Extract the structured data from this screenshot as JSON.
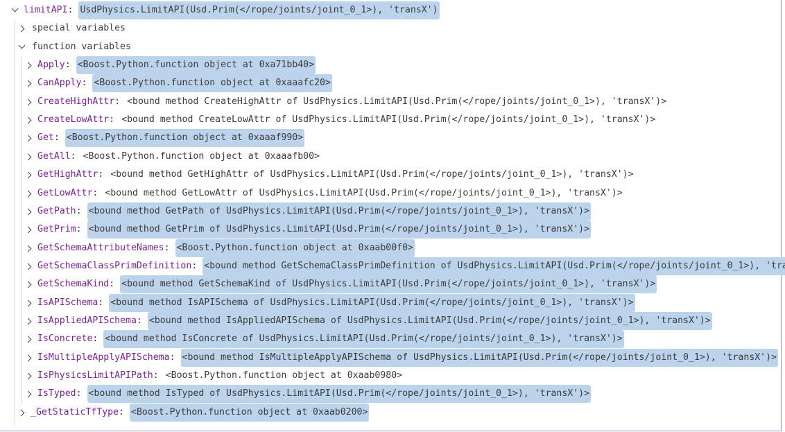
{
  "root": {
    "name": "limitAPI",
    "value": "UsdPhysics.LimitAPI(Usd.Prim(</rope/joints/joint_0_1>), 'transX')",
    "selected": true
  },
  "groups": {
    "special": "special variables",
    "function": "function variables"
  },
  "items": [
    {
      "name": "Apply",
      "value": "<Boost.Python.function object at 0xa71bb40>",
      "selected": true
    },
    {
      "name": "CanApply",
      "value": "<Boost.Python.function object at 0xaaafc20>",
      "selected": true
    },
    {
      "name": "CreateHighAttr",
      "value": "<bound method CreateHighAttr of UsdPhysics.LimitAPI(Usd.Prim(</rope/joints/joint_0_1>), 'transX')>",
      "selected": false
    },
    {
      "name": "CreateLowAttr",
      "value": "<bound method CreateLowAttr of UsdPhysics.LimitAPI(Usd.Prim(</rope/joints/joint_0_1>), 'transX')>",
      "selected": false
    },
    {
      "name": "Get",
      "value": "<Boost.Python.function object at 0xaaaf990>",
      "selected": true
    },
    {
      "name": "GetAll",
      "value": "<Boost.Python.function object at 0xaaafb00>",
      "selected": false
    },
    {
      "name": "GetHighAttr",
      "value": "<bound method GetHighAttr of UsdPhysics.LimitAPI(Usd.Prim(</rope/joints/joint_0_1>), 'transX')>",
      "selected": false
    },
    {
      "name": "GetLowAttr",
      "value": "<bound method GetLowAttr of UsdPhysics.LimitAPI(Usd.Prim(</rope/joints/joint_0_1>), 'transX')>",
      "selected": false
    },
    {
      "name": "GetPath",
      "value": "<bound method GetPath of UsdPhysics.LimitAPI(Usd.Prim(</rope/joints/joint_0_1>), 'transX')>",
      "selected": true
    },
    {
      "name": "GetPrim",
      "value": "<bound method GetPrim of UsdPhysics.LimitAPI(Usd.Prim(</rope/joints/joint_0_1>), 'transX')>",
      "selected": true
    },
    {
      "name": "GetSchemaAttributeNames",
      "value": "<Boost.Python.function object at 0xaab00f0>",
      "selected": true
    },
    {
      "name": "GetSchemaClassPrimDefinition",
      "value": "<bound method GetSchemaClassPrimDefinition of UsdPhysics.LimitAPI(Usd.Prim(</rope/joints/joint_0_1>), 'tran…",
      "selected": true
    },
    {
      "name": "GetSchemaKind",
      "value": "<bound method GetSchemaKind of UsdPhysics.LimitAPI(Usd.Prim(</rope/joints/joint_0_1>), 'transX')>",
      "selected": true
    },
    {
      "name": "IsAPISchema",
      "value": "<bound method IsAPISchema of UsdPhysics.LimitAPI(Usd.Prim(</rope/joints/joint_0_1>), 'transX')>",
      "selected": true
    },
    {
      "name": "IsAppliedAPISchema",
      "value": "<bound method IsAppliedAPISchema of UsdPhysics.LimitAPI(Usd.Prim(</rope/joints/joint_0_1>), 'transX')>",
      "selected": true
    },
    {
      "name": "IsConcrete",
      "value": "<bound method IsConcrete of UsdPhysics.LimitAPI(Usd.Prim(</rope/joints/joint_0_1>), 'transX')>",
      "selected": true
    },
    {
      "name": "IsMultipleApplyAPISchema",
      "value": "<bound method IsMultipleApplyAPISchema of UsdPhysics.LimitAPI(Usd.Prim(</rope/joints/joint_0_1>), 'transX')>",
      "selected": true
    },
    {
      "name": "IsPhysicsLimitAPIPath",
      "value": "<Boost.Python.function object at 0xaab0980>",
      "selected": false
    },
    {
      "name": "IsTyped",
      "value": "<bound method IsTyped of UsdPhysics.LimitAPI(Usd.Prim(</rope/joints/joint_0_1>), 'transX')>",
      "selected": true
    }
  ],
  "tail": {
    "name": "_GetStaticTfType",
    "value": "<Boost.Python.function object at 0xaab0200>",
    "selected": true
  },
  "colors": {
    "name": "#811f9b",
    "selection": "#bcd3ec",
    "text": "#3b3b3b"
  }
}
